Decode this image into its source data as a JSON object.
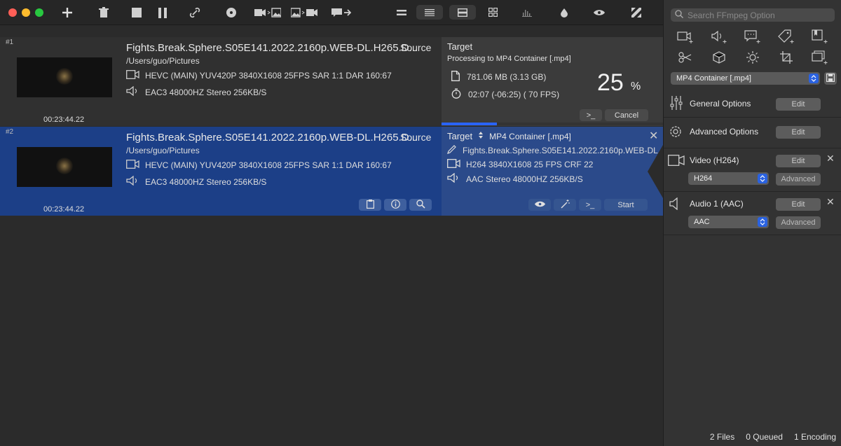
{
  "toolbar": {
    "buttons": [
      "add-icon",
      "trash-icon",
      "stop-icon",
      "pause-icon",
      "link-icon",
      "disc-icon",
      "video-to-image-icon",
      "image-to-video-icon",
      "subtitle-export-icon",
      "equals-icon",
      "list-view-icon",
      "split-view-icon",
      "grid-view-icon",
      "bars-icon",
      "drop-icon",
      "eye-icon",
      "logo-icon"
    ]
  },
  "items": [
    {
      "index": "#1",
      "filename": "Fights.Break.Sphere.S05E141.2022.2160p.WEB-DL.H265.D...",
      "source_label": "Source",
      "path": "/Users/guo/Pictures",
      "video_info": "HEVC (MAIN) YUV420P 3840X1608  25FPS  SAR 1:1 DAR 160:67",
      "audio_info": "EAC3 48000HZ Stereo 256KB/S",
      "duration": "00:23:44.22",
      "target_label": "Target",
      "processing": "Processing to MP4 Container [.mp4]",
      "size": "781.06 MB (3.13 GB)",
      "time": "02:07 (-06:25) ( 70  FPS)",
      "percent": "25",
      "percent_sign": "%",
      "progress": 0.25,
      "terminal_label": ">_",
      "cancel_label": "Cancel"
    },
    {
      "index": "#2",
      "filename": "Fights.Break.Sphere.S05E141.2022.2160p.WEB-DL.H265.D...",
      "source_label": "Source",
      "path": "/Users/guo/Pictures",
      "video_info": "HEVC (MAIN) YUV420P 3840X1608  25FPS  SAR 1:1 DAR 160:67",
      "audio_info": "EAC3 48000HZ Stereo 256KB/S",
      "duration": "00:23:44.22",
      "target_label": "Target",
      "target_container": "MP4 Container [.mp4]",
      "target_filename": "Fights.Break.Sphere.S05E141.2022.2160p.WEB-DL...",
      "target_video": "H264 3840X1608 25 FPS CRF 22",
      "target_audio": "AAC Stereo 48000HZ 256KB/S",
      "terminal_label": ">_",
      "start_label": "Start"
    }
  ],
  "sidebar": {
    "search_placeholder": "Search FFmpeg Option",
    "container": "MP4 Container [.mp4]",
    "general_options": "General Options",
    "advanced_options": "Advanced Options",
    "video_label": "Video (H264)",
    "video_codec": "H264",
    "audio_label": "Audio 1 (AAC)",
    "audio_codec": "AAC",
    "edit": "Edit",
    "advanced": "Advanced"
  },
  "status": {
    "files": "2 Files",
    "queued": "0 Queued",
    "encoding": "1 Encoding"
  },
  "colors": {
    "accent": "#2a64f6",
    "selected_row": "#1c3f87",
    "close_red": "#ff5f57",
    "minimize_yellow": "#febc2e",
    "zoom_green": "#28c840"
  }
}
